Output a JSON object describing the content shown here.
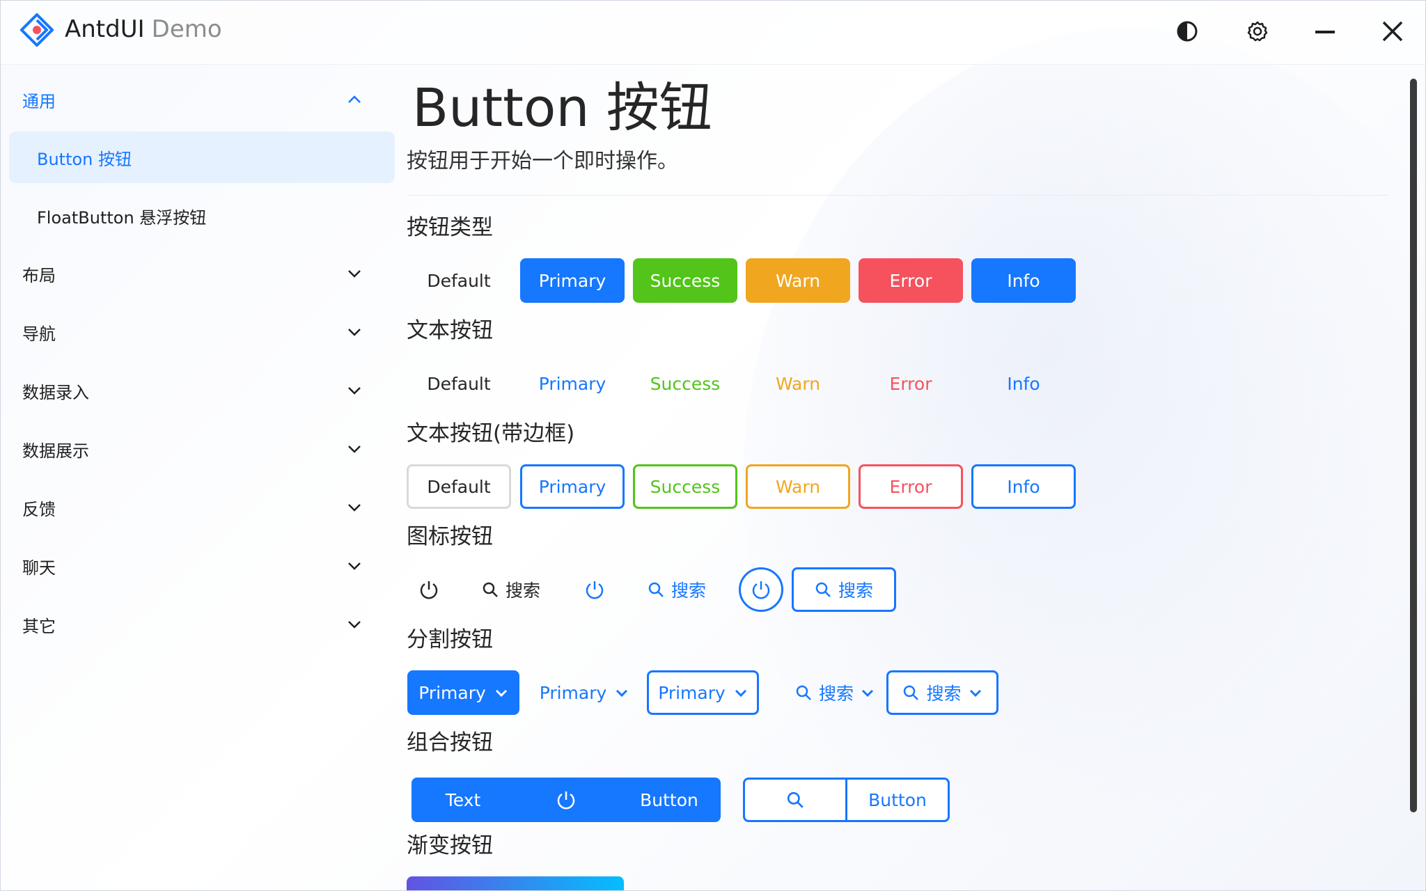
{
  "app": {
    "name": "AntdUI",
    "suffix": "Demo"
  },
  "titlebar": {
    "theme_icon": "contrast-icon",
    "settings_icon": "gear-icon",
    "minimize_icon": "minimize-icon",
    "close_icon": "close-icon"
  },
  "sidebar": {
    "groups": [
      {
        "label": "通用",
        "expanded": true
      },
      {
        "label": "布局"
      },
      {
        "label": "导航"
      },
      {
        "label": "数据录入"
      },
      {
        "label": "数据展示"
      },
      {
        "label": "反馈"
      },
      {
        "label": "聊天"
      },
      {
        "label": "其它"
      }
    ],
    "sub_items": [
      {
        "label": "Button 按钮",
        "active": true
      },
      {
        "label": "FloatButton 悬浮按钮"
      }
    ]
  },
  "page": {
    "title": "Button 按钮",
    "description": "按钮用于开始一个即时操作。",
    "sections": {
      "types": "按钮类型",
      "text": "文本按钮",
      "text_border": "文本按钮(带边框)",
      "icon": "图标按钮",
      "split": "分割按钮",
      "group": "组合按钮",
      "gradient": "渐变按钮"
    },
    "button_labels": [
      "Default",
      "Primary",
      "Success",
      "Warn",
      "Error",
      "Info"
    ],
    "icon_buttons": {
      "search": "搜索"
    },
    "split_buttons": {
      "primary": "Primary",
      "search": "搜索"
    },
    "group_buttons": {
      "text": "Text",
      "button": "Button"
    }
  },
  "colors": {
    "primary": "#1677ff",
    "success": "#52c41a",
    "warn": "#f5a623",
    "error": "#f5525d",
    "info": "#1677ff",
    "default_text": "#262626"
  }
}
